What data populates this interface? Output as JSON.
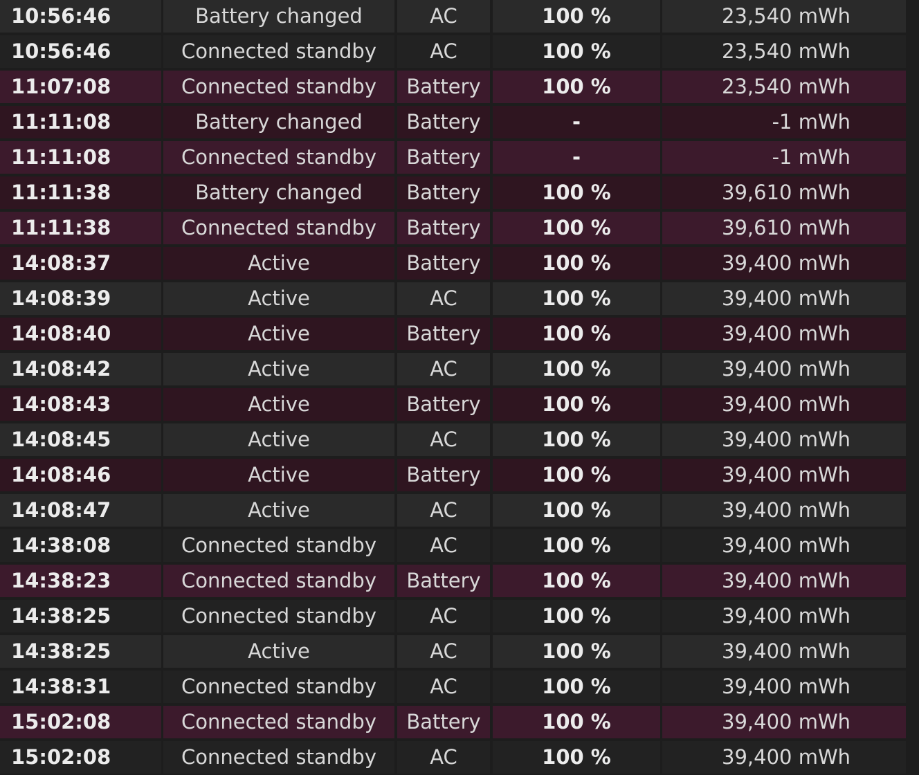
{
  "colors": {
    "page_bg": "#1d1d1d",
    "ac_row_odd": "#2a2a2a",
    "ac_row_even": "#222222",
    "battery_row_odd": "#3c1a2c",
    "battery_row_even": "#2f1520"
  },
  "rows": [
    {
      "time": "10:56:46",
      "state": "Battery changed",
      "source": "AC",
      "percent": "100 %",
      "capacity": "23,540 mWh"
    },
    {
      "time": "10:56:46",
      "state": "Connected standby",
      "source": "AC",
      "percent": "100 %",
      "capacity": "23,540 mWh"
    },
    {
      "time": "11:07:08",
      "state": "Connected standby",
      "source": "Battery",
      "percent": "100 %",
      "capacity": "23,540 mWh"
    },
    {
      "time": "11:11:08",
      "state": "Battery changed",
      "source": "Battery",
      "percent": "-",
      "capacity": "-1 mWh"
    },
    {
      "time": "11:11:08",
      "state": "Connected standby",
      "source": "Battery",
      "percent": "-",
      "capacity": "-1 mWh"
    },
    {
      "time": "11:11:38",
      "state": "Battery changed",
      "source": "Battery",
      "percent": "100 %",
      "capacity": "39,610 mWh"
    },
    {
      "time": "11:11:38",
      "state": "Connected standby",
      "source": "Battery",
      "percent": "100 %",
      "capacity": "39,610 mWh"
    },
    {
      "time": "14:08:37",
      "state": "Active",
      "source": "Battery",
      "percent": "100 %",
      "capacity": "39,400 mWh"
    },
    {
      "time": "14:08:39",
      "state": "Active",
      "source": "AC",
      "percent": "100 %",
      "capacity": "39,400 mWh"
    },
    {
      "time": "14:08:40",
      "state": "Active",
      "source": "Battery",
      "percent": "100 %",
      "capacity": "39,400 mWh"
    },
    {
      "time": "14:08:42",
      "state": "Active",
      "source": "AC",
      "percent": "100 %",
      "capacity": "39,400 mWh"
    },
    {
      "time": "14:08:43",
      "state": "Active",
      "source": "Battery",
      "percent": "100 %",
      "capacity": "39,400 mWh"
    },
    {
      "time": "14:08:45",
      "state": "Active",
      "source": "AC",
      "percent": "100 %",
      "capacity": "39,400 mWh"
    },
    {
      "time": "14:08:46",
      "state": "Active",
      "source": "Battery",
      "percent": "100 %",
      "capacity": "39,400 mWh"
    },
    {
      "time": "14:08:47",
      "state": "Active",
      "source": "AC",
      "percent": "100 %",
      "capacity": "39,400 mWh"
    },
    {
      "time": "14:38:08",
      "state": "Connected standby",
      "source": "AC",
      "percent": "100 %",
      "capacity": "39,400 mWh"
    },
    {
      "time": "14:38:23",
      "state": "Connected standby",
      "source": "Battery",
      "percent": "100 %",
      "capacity": "39,400 mWh"
    },
    {
      "time": "14:38:25",
      "state": "Connected standby",
      "source": "AC",
      "percent": "100 %",
      "capacity": "39,400 mWh"
    },
    {
      "time": "14:38:25",
      "state": "Active",
      "source": "AC",
      "percent": "100 %",
      "capacity": "39,400 mWh"
    },
    {
      "time": "14:38:31",
      "state": "Connected standby",
      "source": "AC",
      "percent": "100 %",
      "capacity": "39,400 mWh"
    },
    {
      "time": "15:02:08",
      "state": "Connected standby",
      "source": "Battery",
      "percent": "100 %",
      "capacity": "39,400 mWh"
    },
    {
      "time": "15:02:08",
      "state": "Connected standby",
      "source": "AC",
      "percent": "100 %",
      "capacity": "39,400 mWh"
    }
  ]
}
